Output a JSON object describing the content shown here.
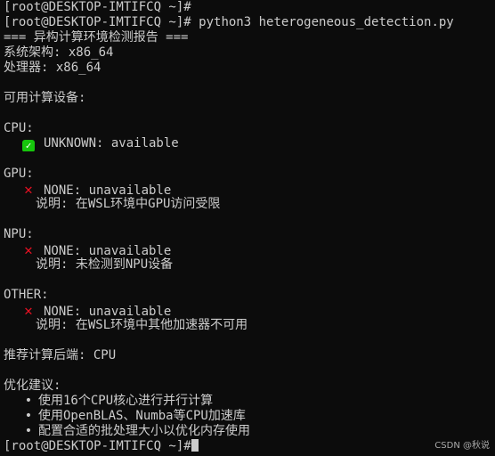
{
  "prompt": "[root@DESKTOP-IMTIFCQ ~]#",
  "command": "python3 heterogeneous_detection.py",
  "report_title": "=== 异构计算环境检测报告 ===",
  "arch_line": "系统架构: x86_64",
  "cpu_arch_line": "处理器: x86_64",
  "devices_heading": "可用计算设备:",
  "sections": [
    {
      "name": "CPU:",
      "status_icon": "check-icon",
      "status": "UNKNOWN: available",
      "note": ""
    },
    {
      "name": "GPU:",
      "status_icon": "cross-icon",
      "status": "NONE: unavailable",
      "note": "说明: 在WSL环境中GPU访问受限"
    },
    {
      "name": "NPU:",
      "status_icon": "cross-icon",
      "status": "NONE: unavailable",
      "note": "说明: 未检测到NPU设备"
    },
    {
      "name": "OTHER:",
      "status_icon": "cross-icon",
      "status": "NONE: unavailable",
      "note": "说明: 在WSL环境中其他加速器不可用"
    }
  ],
  "backend_line": "推荐计算后端: CPU",
  "suggest_heading": "优化建议:",
  "suggestions": [
    "使用16个CPU核心进行并行计算",
    "使用OpenBLAS、Numba等CPU加速库",
    "配置合适的批处理大小以优化内存使用"
  ],
  "watermark": "CSDN @秋说",
  "colors": {
    "background": "#0c0c0c",
    "text": "#cccccc",
    "check": "#16c60c",
    "cross": "#e81123"
  }
}
